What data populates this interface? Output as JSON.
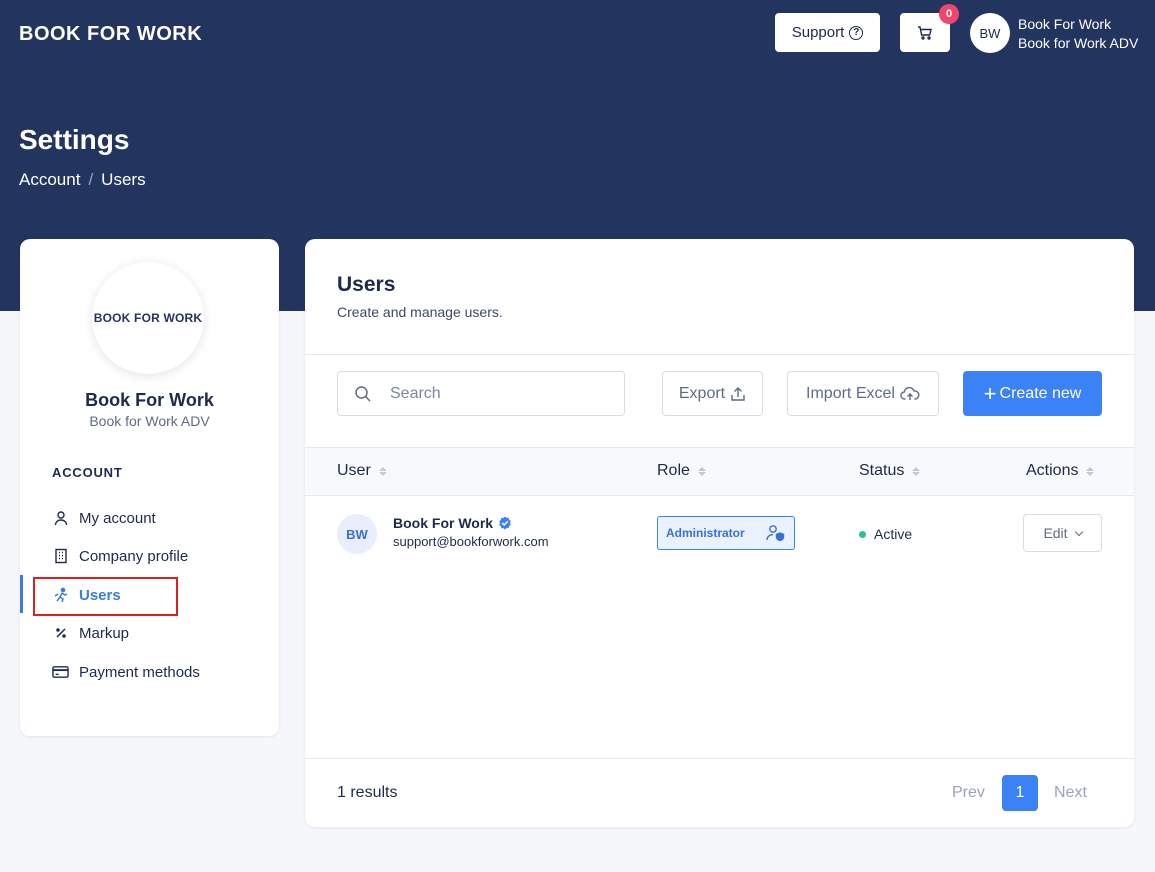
{
  "header": {
    "logo": "BOOK FOR WORK",
    "support_label": "Support",
    "cart_count": "0",
    "avatar_initials": "BW",
    "user_name": "Book For Work",
    "user_company": "Book for Work ADV"
  },
  "page": {
    "title": "Settings",
    "breadcrumb": [
      "Account",
      "/",
      "Users"
    ]
  },
  "sidebar": {
    "logo_text": "BOOK FOR WORK",
    "name": "Book For Work",
    "company": "Book for Work ADV",
    "section": "ACCOUNT",
    "items": [
      {
        "label": "My account",
        "icon": "user-icon"
      },
      {
        "label": "Company profile",
        "icon": "building-icon"
      },
      {
        "label": "Users",
        "icon": "users-icon",
        "active": true
      },
      {
        "label": "Markup",
        "icon": "percent-icon"
      },
      {
        "label": "Payment methods",
        "icon": "credit-card-icon"
      }
    ]
  },
  "users": {
    "title": "Users",
    "subtitle": "Create and manage users.",
    "search_placeholder": "Search",
    "export_label": "Export",
    "import_label": "Import Excel",
    "create_label": "Create new",
    "columns": [
      "User",
      "Role",
      "Status",
      "Actions"
    ],
    "rows": [
      {
        "initials": "BW",
        "name": "Book For Work",
        "email": "support@bookforwork.com",
        "role": "Administrator",
        "status": "Active",
        "action": "Edit"
      }
    ],
    "results": "1 results",
    "pagination": {
      "prev": "Prev",
      "current": "1",
      "next": "Next"
    }
  },
  "colors": {
    "header_bg": "#23345e",
    "accent": "#3b82f6",
    "badge": "#f0466e",
    "status_active": "#22c39a",
    "highlight": "#e02020"
  }
}
